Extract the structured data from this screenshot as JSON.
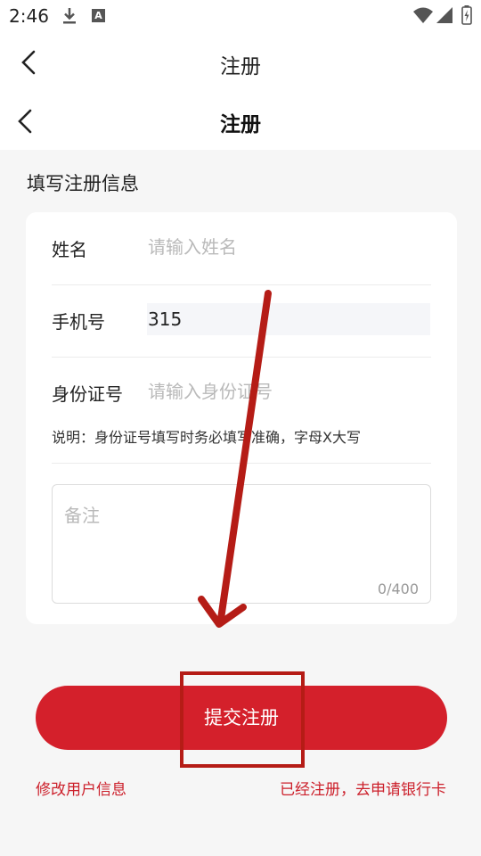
{
  "status_bar": {
    "time": "2:46",
    "icons": [
      "download-icon",
      "a-badge-icon",
      "wifi-icon",
      "signal-icon",
      "battery-icon"
    ],
    "a_badge": "A"
  },
  "nav_top": {
    "title": "注册",
    "back_icon": "chevron-left-icon"
  },
  "nav_main": {
    "title": "注册",
    "back_icon": "chevron-left-icon"
  },
  "form": {
    "heading": "填写注册信息",
    "name": {
      "label": "姓名",
      "placeholder": "请输入姓名",
      "value": ""
    },
    "phone": {
      "label": "手机号",
      "placeholder": "",
      "value": "315"
    },
    "id_number": {
      "label": "身份证号",
      "placeholder": "请输入身份证号",
      "value": ""
    },
    "note": "说明：身份证号填写时务必填写准确，字母X大写",
    "remark": {
      "placeholder": "备注",
      "counter": "0/400"
    }
  },
  "actions": {
    "submit_label": "提交注册",
    "edit_user_link": "修改用户信息",
    "apply_card_link": "已经注册，去申请银行卡"
  },
  "colors": {
    "primary": "#d4202b",
    "annotation": "#b51c16",
    "background": "#f6f6f6"
  }
}
